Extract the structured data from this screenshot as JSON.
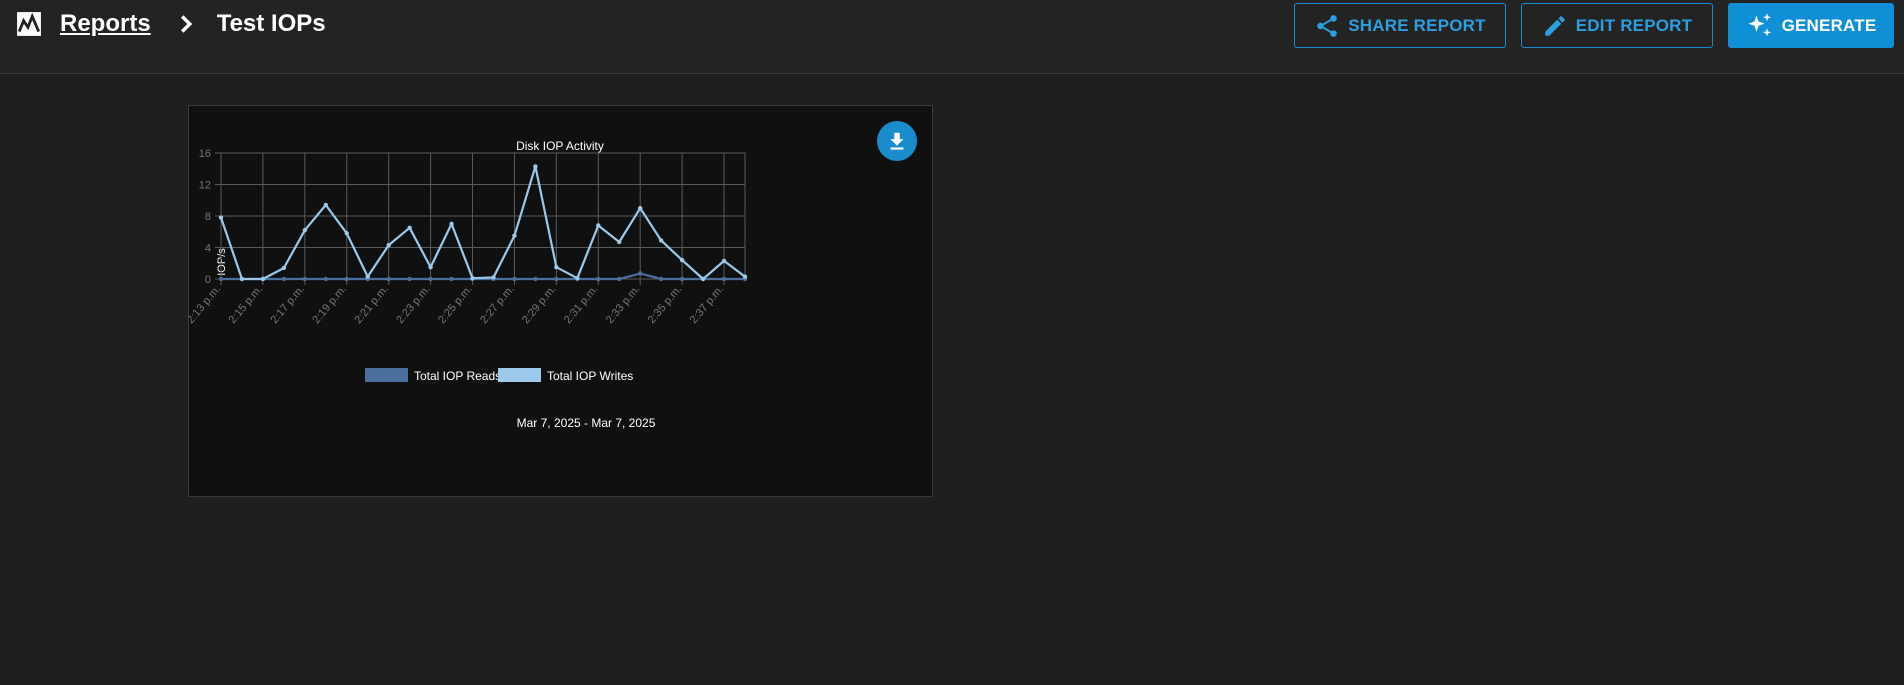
{
  "header": {
    "breadcrumb_root": "Reports",
    "page_title": "Test IOPs",
    "share_label": "SHARE REPORT",
    "edit_label": "EDIT REPORT",
    "generate_label": "GENERATE"
  },
  "colors": {
    "accent": "#1a8ccc",
    "reads": "#4a6f9c",
    "writes": "#9cc9ea"
  },
  "icons": [
    "reports-logo-icon",
    "chevron-right-icon",
    "share-icon",
    "pencil-icon",
    "sparkle-icon",
    "download-icon"
  ],
  "chart_data": {
    "type": "line",
    "title": "Disk IOP Activity",
    "xlabel": "Mar 7, 2025 - Mar 7, 2025",
    "ylabel": "IOP/s",
    "ylim": [
      0,
      16
    ],
    "yticks": [
      0,
      4,
      8,
      12,
      16
    ],
    "grid": true,
    "legend_position": "bottom",
    "x": [
      "2:13 p.m.",
      "",
      "2:15 p.m.",
      "",
      "2:17 p.m.",
      "",
      "2:19 p.m.",
      "",
      "2:21 p.m.",
      "",
      "2:23 p.m.",
      "",
      "2:25 p.m.",
      "",
      "2:27 p.m.",
      "",
      "2:29 p.m.",
      "",
      "2:31 p.m.",
      "",
      "2:33 p.m.",
      "",
      "2:35 p.m.",
      "",
      "2:37 p.m.",
      ""
    ],
    "series": [
      {
        "name": "Total IOP Reads",
        "values": [
          0,
          0,
          0,
          0,
          0,
          0,
          0,
          0,
          0,
          0,
          0,
          0,
          0,
          0,
          0,
          0,
          0,
          0,
          0,
          0,
          0.7,
          0,
          0,
          0,
          0,
          0
        ]
      },
      {
        "name": "Total IOP Writes",
        "values": [
          7.8,
          0,
          0,
          1.4,
          6.2,
          9.4,
          5.8,
          0.3,
          4.3,
          6.5,
          1.5,
          7.0,
          0.1,
          0.2,
          5.5,
          14.3,
          1.5,
          0.1,
          6.8,
          4.7,
          9.0,
          4.9,
          2.4,
          0,
          2.3,
          0.3
        ]
      }
    ]
  }
}
